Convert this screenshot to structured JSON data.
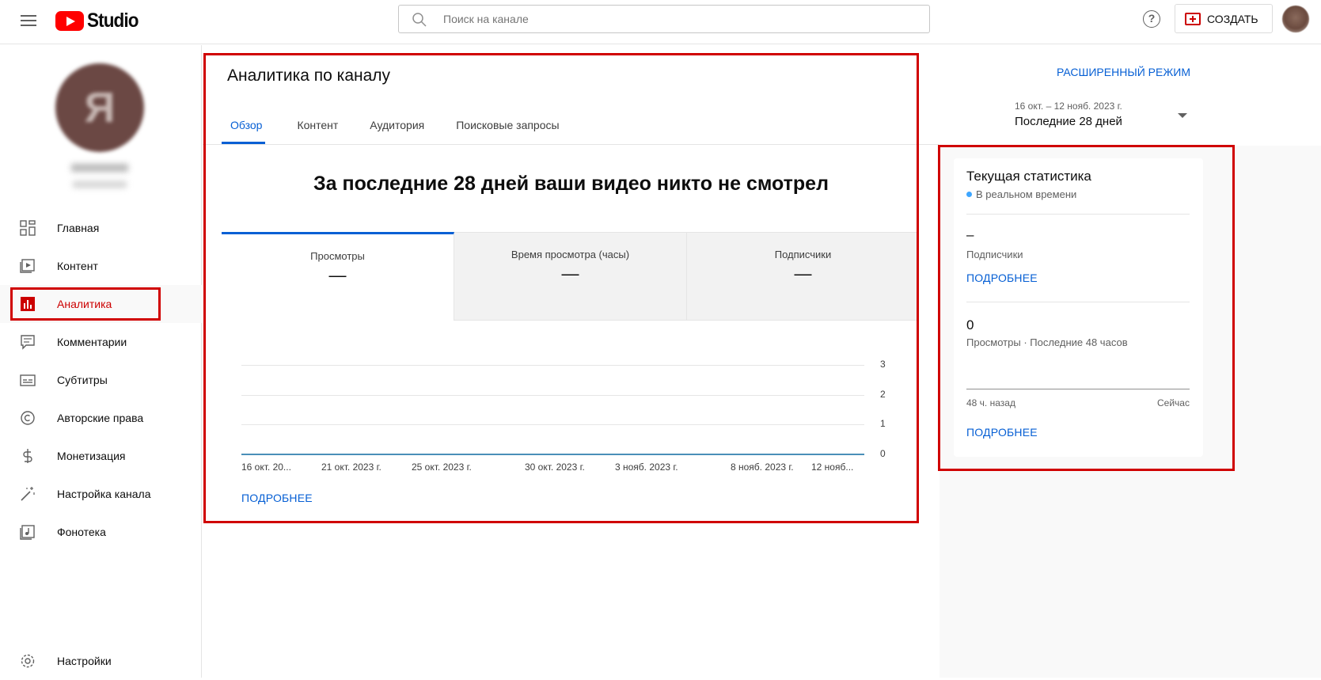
{
  "app": {
    "logo_text": "Studio"
  },
  "header": {
    "search_placeholder": "Поиск на канале",
    "help_label": "?",
    "create_label": "СОЗДАТЬ"
  },
  "sidebar": {
    "avatar_letter": "Я",
    "items": [
      {
        "label": "Главная",
        "icon": "dashboard-icon"
      },
      {
        "label": "Контент",
        "icon": "content-icon"
      },
      {
        "label": "Аналитика",
        "icon": "analytics-icon",
        "active": true
      },
      {
        "label": "Комментарии",
        "icon": "comments-icon"
      },
      {
        "label": "Субтитры",
        "icon": "subtitles-icon"
      },
      {
        "label": "Авторские права",
        "icon": "copyright-icon"
      },
      {
        "label": "Монетизация",
        "icon": "monetization-icon"
      },
      {
        "label": "Настройка канала",
        "icon": "customization-icon"
      },
      {
        "label": "Фонотека",
        "icon": "audio-library-icon"
      }
    ],
    "settings_label": "Настройки"
  },
  "main": {
    "title": "Аналитика по каналу",
    "tabs": [
      "Обзор",
      "Контент",
      "Аудитория",
      "Поисковые запросы"
    ],
    "headline": "За последние 28 дней ваши видео никто не смотрел",
    "metrics": [
      {
        "label": "Просмотры",
        "value": "—"
      },
      {
        "label": "Время просмотра (часы)",
        "value": "—"
      },
      {
        "label": "Подписчики",
        "value": "—"
      }
    ],
    "more_label": "ПОДРОБНЕЕ"
  },
  "chart_data": {
    "type": "line",
    "x": [
      "16 окт. 20...",
      "21 окт. 2023 г.",
      "25 окт. 2023 г.",
      "30 окт. 2023 г.",
      "3 нояб. 2023 г.",
      "8 нояб. 2023 г.",
      "12 нояб..."
    ],
    "series": [
      {
        "values": [
          0,
          0,
          0,
          0,
          0,
          0,
          0
        ]
      }
    ],
    "y_ticks": [
      "3",
      "2",
      "1",
      "0"
    ],
    "ylim": [
      0,
      3
    ],
    "grid": true,
    "color": "#4a8fb8"
  },
  "right": {
    "advanced_mode": "РАСШИРЕННЫЙ РЕЖИМ",
    "date_range": "16 окт. – 12 нояб. 2023 г.",
    "period": "Последние 28 дней",
    "realtime": {
      "title": "Текущая статистика",
      "live_label": "В реальном времени",
      "subs_value": "–",
      "subs_label": "Подписчики",
      "more1": "ПОДРОБНЕЕ",
      "views_value": "0",
      "views_label": "Просмотры · Последние 48 часов",
      "axis_left": "48 ч. назад",
      "axis_right": "Сейчас",
      "more2": "ПОДРОБНЕЕ"
    }
  },
  "colors": {
    "accent": "#065fd4",
    "brand": "#ff0000",
    "active_nav": "#cc0000",
    "annotation": "#d00000"
  }
}
